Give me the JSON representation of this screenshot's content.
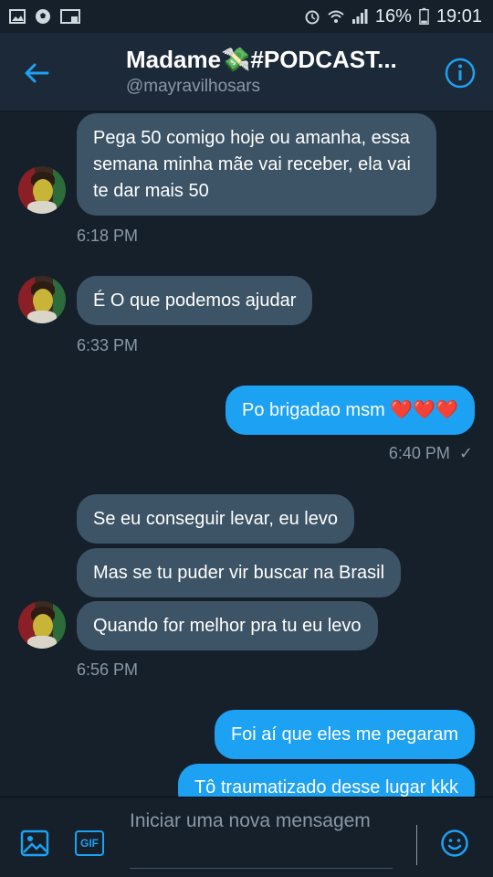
{
  "status_bar": {
    "battery": "16%",
    "time": "19:01"
  },
  "header": {
    "title": "Madame💸#PODCAST...",
    "handle": "@mayravilhosars"
  },
  "messages": [
    {
      "side": "received",
      "text": "Pega 50 comigo hoje ou amanha, essa semana minha mãe vai receber, ela vai te dar mais 50"
    },
    {
      "side": "received",
      "time": "6:18 PM"
    },
    {
      "side": "received",
      "text": "É O que podemos ajudar"
    },
    {
      "side": "received",
      "time": "6:33 PM"
    },
    {
      "side": "sent",
      "text": "Po brigadao msm ❤️❤️❤️"
    },
    {
      "side": "sent",
      "time": "6:40 PM"
    },
    {
      "side": "received",
      "text": "Se eu conseguir levar, eu levo"
    },
    {
      "side": "received",
      "text": "Mas se tu puder vir buscar na Brasil"
    },
    {
      "side": "received",
      "text": "Quando for melhor pra tu eu levo"
    },
    {
      "side": "received",
      "time": "6:56 PM"
    },
    {
      "side": "sent",
      "text": "Foi aí que eles me pegaram"
    },
    {
      "side": "sent",
      "text": "Tô traumatizado desse lugar kkk"
    }
  ],
  "composer": {
    "placeholder": "Iniciar uma nova mensagem",
    "gif_label": "GIF"
  },
  "colors": {
    "background": "#15202b",
    "received_bubble": "#3d5466",
    "sent_bubble": "#1da1f2",
    "accent": "#1da1f2",
    "muted_text": "#8899a6"
  },
  "icons": {
    "status_left": [
      "image-icon",
      "soccer-ball-icon",
      "cast-icon"
    ],
    "status_right": [
      "alarm-icon",
      "wifi-icon",
      "signal-icon",
      "battery-icon"
    ],
    "header": [
      "back-arrow-icon",
      "info-icon"
    ],
    "composer": [
      "image-icon",
      "gif-icon",
      "emoji-icon"
    ]
  }
}
